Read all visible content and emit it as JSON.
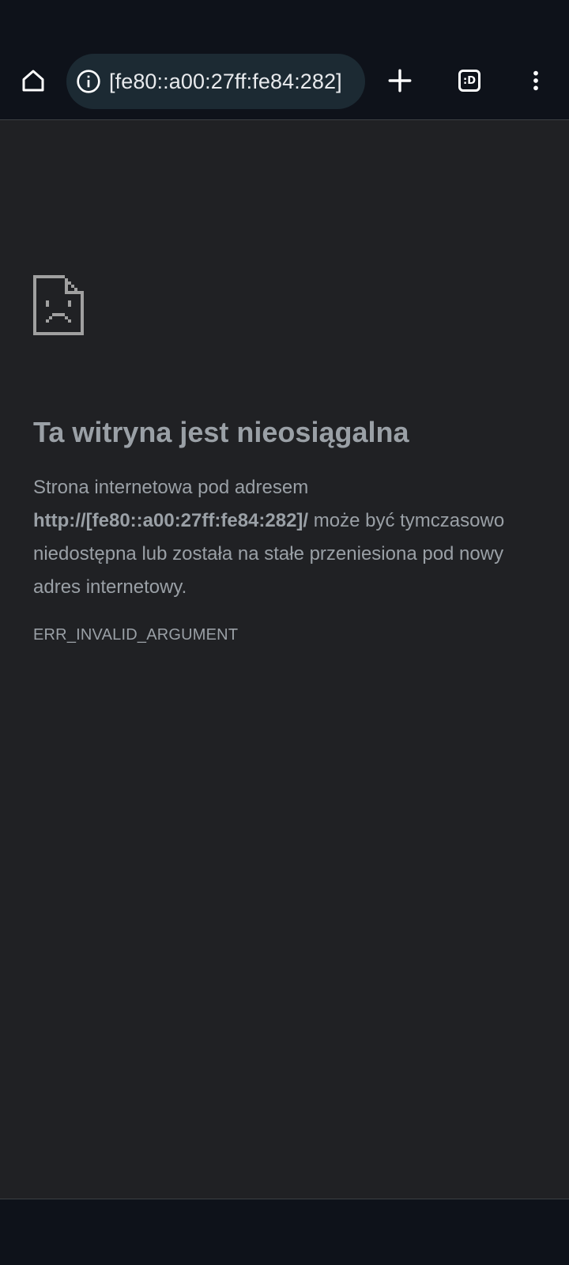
{
  "toolbar": {
    "url": "[fe80::a00:27ff:fe84:282]",
    "tab_count_label": ":D",
    "icons": {
      "home": "home-icon",
      "info": "info-icon",
      "new_tab": "plus-icon",
      "tabs": "tab-switcher-icon",
      "menu": "more-vert-icon"
    }
  },
  "error_page": {
    "icon": "sad-page-icon",
    "title": "Ta witryna jest nieosiągalna",
    "description_prefix": "Strona internetowa pod adresem",
    "description_url": "http://[fe80::a00:27ff:fe84:282]/",
    "description_suffix": "może być tymczasowo niedostępna lub została na stałe przeniesiona pod nowy adres internetowy.",
    "error_code": "ERR_INVALID_ARGUMENT"
  },
  "colors": {
    "chrome_bg": "#0e121a",
    "page_bg": "#202124",
    "omnibox_bg": "#1c2a33",
    "text_muted": "#9aa0a6",
    "icon_gray": "#a0a0a0"
  }
}
